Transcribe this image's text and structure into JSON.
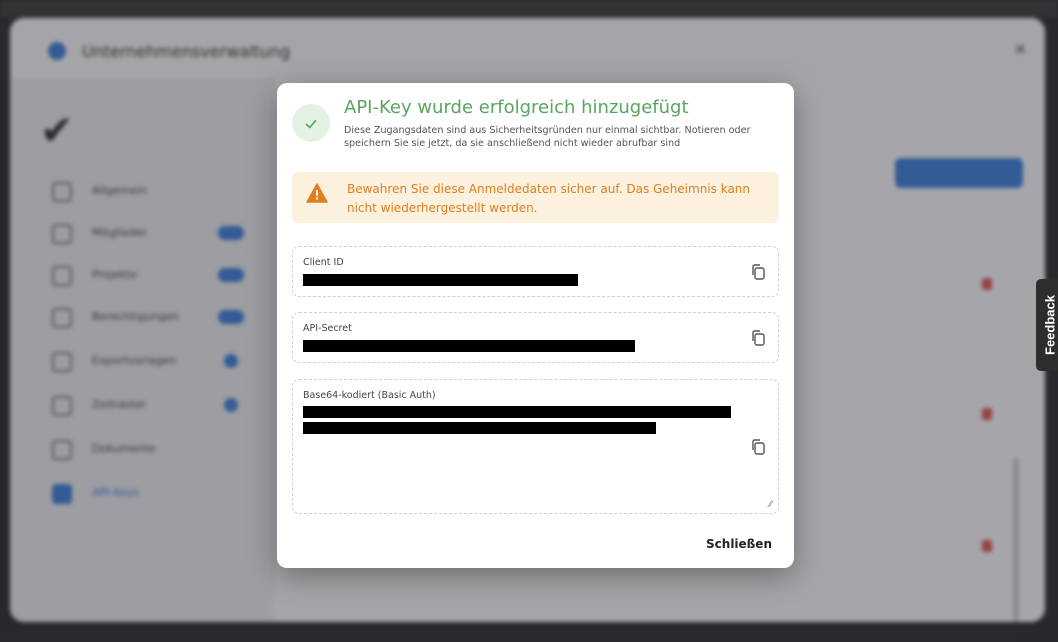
{
  "background": {
    "app_title": "Unternehmensverwaltung",
    "nav_items": [
      {
        "label": "Allgemein"
      },
      {
        "label": "Mitglieder"
      },
      {
        "label": "Projekte"
      },
      {
        "label": "Berechtigungen"
      },
      {
        "label": "Exportvorlagen"
      },
      {
        "label": "Zeitraster"
      },
      {
        "label": "Dokumente"
      },
      {
        "label": "API-Keys"
      }
    ]
  },
  "modal": {
    "title": "API-Key wurde erfolgreich hinzugefügt",
    "subtitle": "Diese Zugangsdaten sind aus Sicherheitsgründen nur einmal sichtbar. Notieren oder speichern Sie sie jetzt, da sie anschließend nicht wieder abrufbar sind",
    "warning": "Bewahren Sie diese Anmeldedaten sicher auf. Das Geheimnis kann nicht wiederhergestellt werden.",
    "fields": {
      "client_id": {
        "label": "Client ID"
      },
      "api_secret": {
        "label": "API-Secret"
      },
      "base64": {
        "label": "Base64-kodiert (Basic Auth)"
      }
    },
    "close_label": "Schließen"
  },
  "feedback_label": "Feedback",
  "colors": {
    "success": "#5aa55e",
    "warning_text": "#e07f1f",
    "warning_bg": "#fcf0df",
    "accent": "#3a7bd5"
  }
}
